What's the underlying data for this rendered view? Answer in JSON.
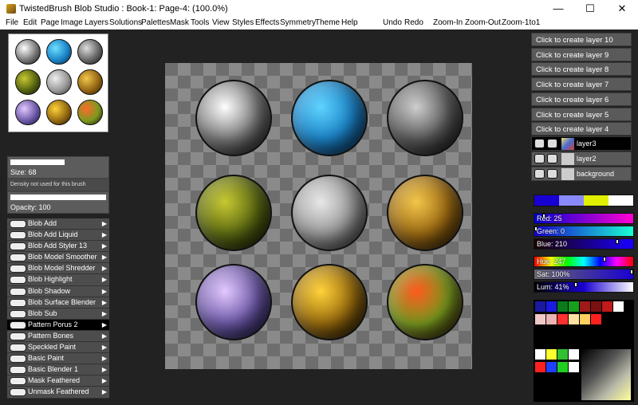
{
  "window": {
    "title": "TwistedBrush Blob Studio : Book-1: Page-4:  (100.0%)",
    "minimize": "—",
    "maximize": "☐",
    "close": "✕"
  },
  "menu": [
    "File",
    "Edit",
    "Page",
    "Image",
    "Layers",
    "Solutions",
    "Palettes",
    "Mask",
    "Tools",
    "View",
    "Styles",
    "Effects",
    "Symmetry",
    "Theme",
    "Help"
  ],
  "actions": [
    "Undo",
    "Redo",
    "Zoom-In",
    "Zoom-Out",
    "Zoom-1to1"
  ],
  "brush_controls": {
    "size": "Size: 68",
    "density": "Density not used for this brush",
    "opacity": "Opacity: 100"
  },
  "brushes": [
    {
      "label": "Blob Add",
      "selected": false
    },
    {
      "label": "Blob Add Liquid",
      "selected": false
    },
    {
      "label": "Blob Add Styler 13",
      "selected": false
    },
    {
      "label": "Blob Model Smoother",
      "selected": false
    },
    {
      "label": "Blob Model Shredder",
      "selected": false
    },
    {
      "label": "Blob Highlight",
      "selected": false
    },
    {
      "label": "Blob Shadow",
      "selected": false
    },
    {
      "label": "Blob Surface Blender",
      "selected": false
    },
    {
      "label": "Blob Sub",
      "selected": false
    },
    {
      "label": "Pattern Porus 2",
      "selected": true
    },
    {
      "label": "Pattern Bones",
      "selected": false
    },
    {
      "label": "Speckled Paint",
      "selected": false
    },
    {
      "label": "Basic Paint",
      "selected": false
    },
    {
      "label": "Basic Blender 1",
      "selected": false
    },
    {
      "label": "Mask Feathered",
      "selected": false
    },
    {
      "label": "Unmask Feathered",
      "selected": false
    }
  ],
  "layers": {
    "create_buttons": [
      "Click to create layer 10",
      "Click to create layer 9",
      "Click to create layer 8",
      "Click to create layer 7",
      "Click to create layer 6",
      "Click to create layer 5",
      "Click to create layer 4"
    ],
    "existing": [
      {
        "name": "layer3",
        "active": true
      },
      {
        "name": "layer2",
        "active": false
      },
      {
        "name": "background",
        "active": false
      }
    ]
  },
  "color": {
    "red": "Red: 25",
    "green": "Green: 0",
    "blue": "Blue: 210",
    "hue": "Hue: 247",
    "sat": "Sat: 100%",
    "lum": "Lum: 41%",
    "current": "#1900d2"
  },
  "spheres": [
    {
      "name": "white-swirl",
      "colors": [
        "#ffffff",
        "#7a7a7a",
        "#1a1a1a"
      ]
    },
    {
      "name": "blue-texture",
      "colors": [
        "#5fd3ff",
        "#1b84c8",
        "#0a2a55"
      ]
    },
    {
      "name": "gray-rings",
      "colors": [
        "#cfcfcf",
        "#5a5a5a",
        "#111111"
      ]
    },
    {
      "name": "olive-speckle",
      "colors": [
        "#c7c832",
        "#5d6a12",
        "#111a05"
      ]
    },
    {
      "name": "gray-smooth",
      "colors": [
        "#e8e8e8",
        "#9a9a9a",
        "#3a3a3a"
      ]
    },
    {
      "name": "gold-speckle",
      "colors": [
        "#f3c64b",
        "#9c6a12",
        "#2e1c05"
      ]
    },
    {
      "name": "purple-nebula",
      "colors": [
        "#e3c9ff",
        "#6e5aa8",
        "#141240"
      ]
    },
    {
      "name": "gold-blotch",
      "colors": [
        "#ffd23a",
        "#9a6d0e",
        "#1c1204"
      ]
    },
    {
      "name": "red-green-speckle",
      "colors": [
        "#ff5a1e",
        "#7a9a1e",
        "#2a0c05"
      ]
    }
  ]
}
